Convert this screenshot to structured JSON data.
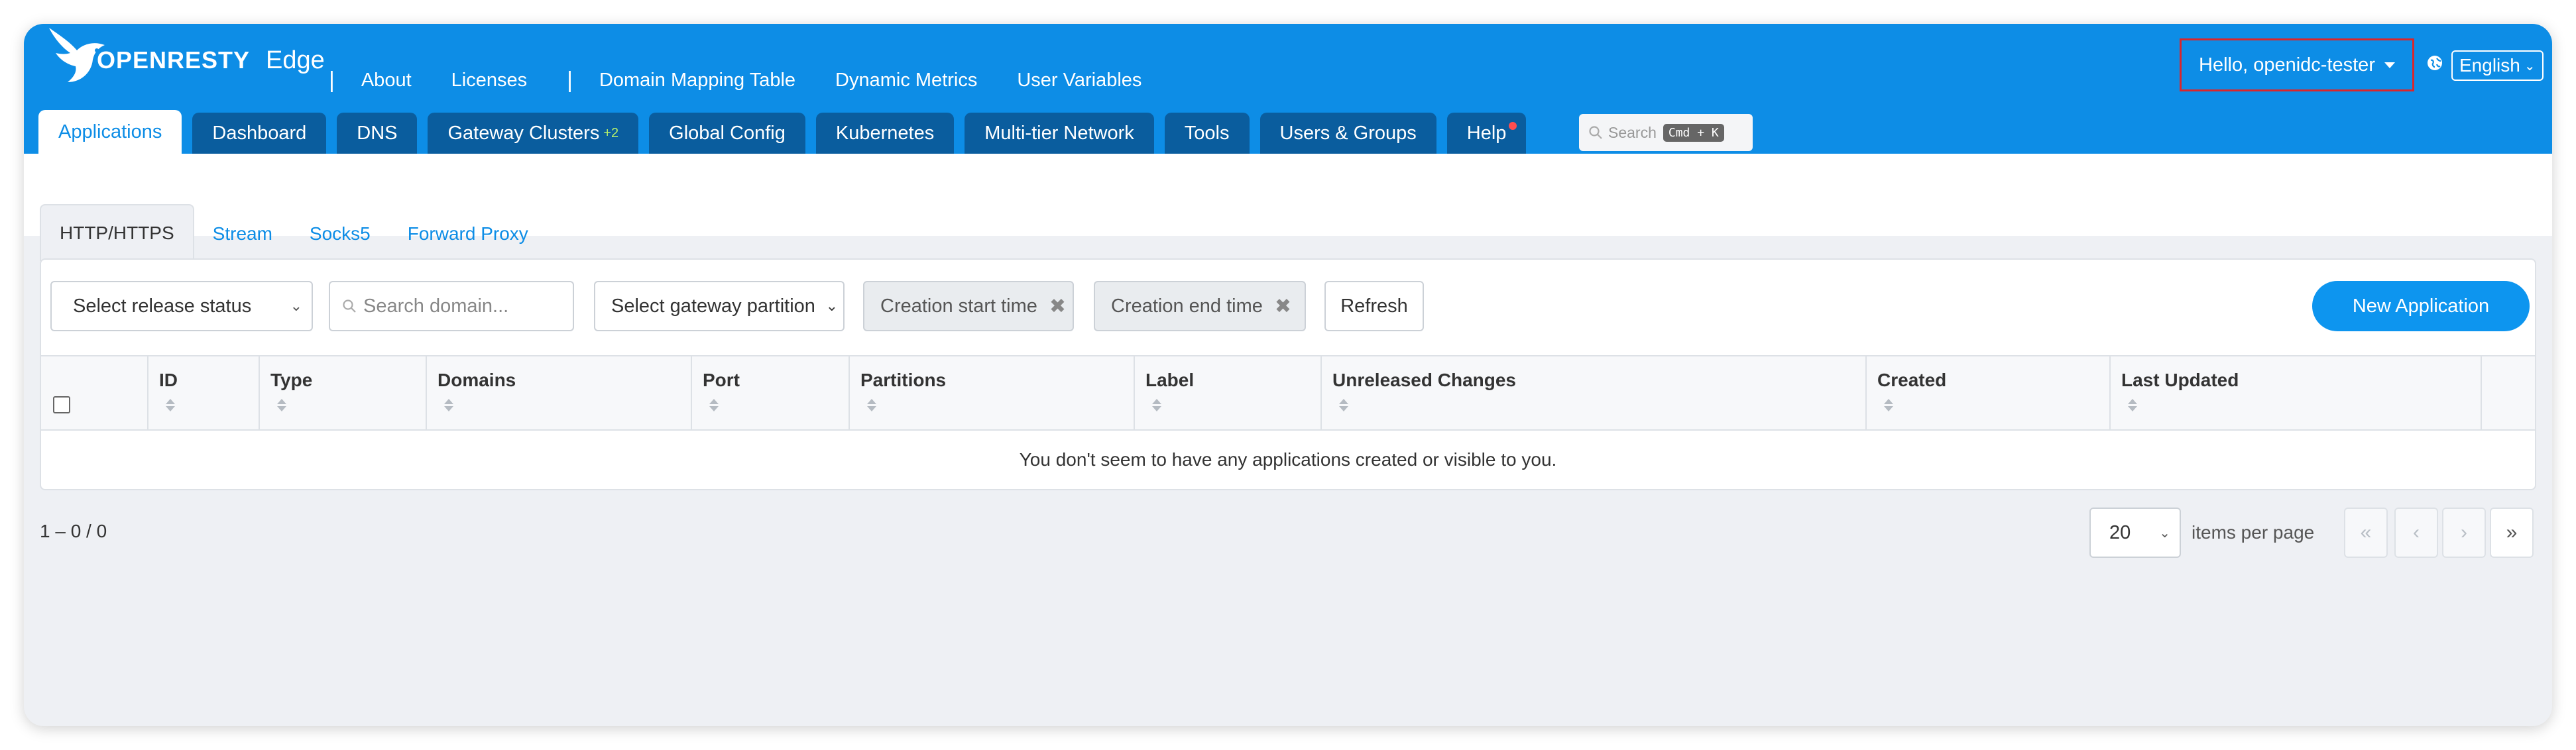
{
  "brand": {
    "logo_text": "OPENRESTY",
    "product": "Edge"
  },
  "top_nav": [
    "About",
    "Licenses",
    "Domain Mapping Table",
    "Dynamic Metrics",
    "User Variables"
  ],
  "user": {
    "greeting": "Hello, openidc-tester"
  },
  "language": {
    "selected": "English"
  },
  "tabs": [
    {
      "label": "Applications",
      "active": true
    },
    {
      "label": "Dashboard"
    },
    {
      "label": "DNS"
    },
    {
      "label": "Gateway Clusters",
      "badge": "+2"
    },
    {
      "label": "Global Config"
    },
    {
      "label": "Kubernetes"
    },
    {
      "label": "Multi-tier Network"
    },
    {
      "label": "Tools"
    },
    {
      "label": "Users & Groups"
    },
    {
      "label": "Help",
      "dot": true
    }
  ],
  "search": {
    "placeholder": "Search",
    "shortcut": "Cmd + K"
  },
  "subtabs": [
    "HTTP/HTTPS",
    "Stream",
    "Socks5",
    "Forward Proxy"
  ],
  "filters": {
    "release_status_placeholder": "Select release status",
    "domain_search_placeholder": "Search domain...",
    "gateway_partition_placeholder": "Select gateway partition",
    "creation_start": "Creation start time",
    "creation_end": "Creation end time",
    "refresh": "Refresh",
    "new_application": "New Application"
  },
  "table": {
    "columns": [
      "ID",
      "Type",
      "Domains",
      "Port",
      "Partitions",
      "Label",
      "Unreleased Changes",
      "Created",
      "Last Updated"
    ],
    "empty_message": "You don't seem to have any applications created or visible to you."
  },
  "pagination": {
    "range": "1 – 0 / 0",
    "per_page": "20",
    "per_page_label": "items per page"
  },
  "colors": {
    "primary": "#0d8de6",
    "tab_dark": "#0a5d9e",
    "highlight": "#d9262c"
  },
  "icons": [
    "bird-logo-icon",
    "chevron-down-icon",
    "globe-icon",
    "search-icon",
    "close-icon",
    "sort-icon",
    "first-page-icon",
    "prev-page-icon",
    "next-page-icon",
    "last-page-icon"
  ]
}
